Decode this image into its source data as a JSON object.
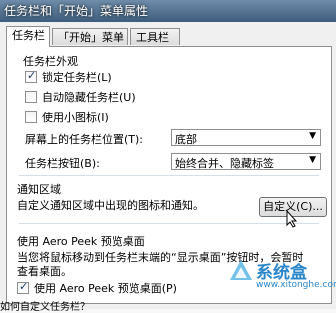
{
  "window": {
    "title": "任务栏和「开始」菜单属性"
  },
  "tabs": [
    {
      "label": "任务栏"
    },
    {
      "label": "「开始」菜单"
    },
    {
      "label": "工具栏"
    }
  ],
  "taskbar": {
    "appearance_label": "任务栏外观",
    "options": [
      {
        "label": "锁定任务栏(L)",
        "checked": true
      },
      {
        "label": "自动隐藏任务栏(U)",
        "checked": false
      },
      {
        "label": "使用小图标(I)",
        "checked": false
      }
    ],
    "location_label": "屏幕上的任务栏位置(T):",
    "location_value": "底部",
    "buttons_label": "任务栏按钮(B):",
    "buttons_value": "始终合并、隐藏标签"
  },
  "notification": {
    "label": "通知区域",
    "description": "自定义通知区域中出现的图标和通知。",
    "customize_button": "自定义(C)..."
  },
  "aero_peek": {
    "label": "使用 Aero Peek 预览桌面",
    "description_1": "当您将鼠标移动到任务栏末端的“显示桌面”按钮时，会暂时",
    "description_2": "查看桌面。",
    "checkbox_label": "使用 Aero Peek 预览桌面(P)",
    "checked": true
  },
  "footer_text": "如何自定义任务栏？",
  "watermark": {
    "brand": "系统盒",
    "url": "www.xitonghe.com"
  }
}
